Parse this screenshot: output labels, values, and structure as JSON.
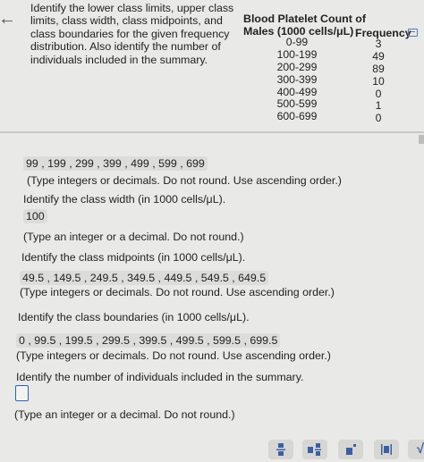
{
  "question": {
    "text": "Identify the lower class limits, upper class limits, class width, class midpoints, and class boundaries for the given frequency distribution. Also identify the number of individuals included in the summary."
  },
  "table": {
    "title": "Blood Platelet Count of Males (1000 cells/μL)",
    "freq_header": "Frequency",
    "classes": [
      "0-99",
      "100-199",
      "200-299",
      "300-399",
      "400-499",
      "500-599",
      "600-699"
    ],
    "frequencies": [
      "3",
      "49",
      "89",
      "10",
      "0",
      "1",
      "0"
    ]
  },
  "answers": {
    "upper_limits": "99 , 199 , 299 , 399 , 499 , 599 , 699",
    "upper_limits_note": "(Type integers or decimals. Do not round. Use ascending order.)",
    "width_prompt": "Identify the class width (in 1000 cells/μL).",
    "width_value": "100",
    "width_note": "(Type an integer or a decimal. Do not round.)",
    "midpoints_prompt": "Identify the class midpoints (in 1000 cells/μL).",
    "midpoints_value": "49.5 , 149.5 , 249.5 , 349.5 , 449.5 , 549.5 , 649.5",
    "midpoints_note": "(Type integers or decimals. Do not round. Use ascending order.)",
    "boundaries_prompt": "Identify the class boundaries (in 1000 cells/μL).",
    "boundaries_value": "0 , 99.5 , 199.5 , 299.5 , 399.5 , 499.5 , 599.5 , 699.5",
    "boundaries_note": "(Type integers or decimals. Do not round. Use ascending order.)",
    "count_prompt": "Identify the number of individuals included in the summary.",
    "count_note": "(Type an integer or a decimal. Do not round.)"
  },
  "toolbar": {
    "icons": [
      "fraction-icon",
      "mixed-number-icon",
      "exponent-icon",
      "absolute-value-icon",
      "sqrt-icon"
    ],
    "sqrt_label": "√"
  }
}
